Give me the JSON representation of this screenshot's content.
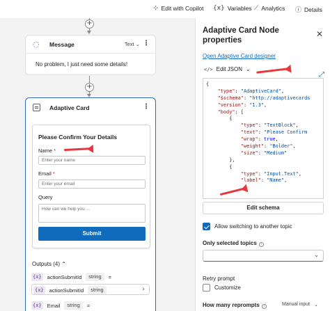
{
  "toolbar": {
    "edit_with_copilot": "Edit with Copilot",
    "variables": "Variables",
    "analytics": "Analytics",
    "details": "Details"
  },
  "message_node": {
    "title": "Message",
    "type_selector": "Text",
    "body": "No problem, I just need some details!"
  },
  "card_node": {
    "title": "Adaptive Card",
    "form": {
      "title": "Please Confirm Your Details",
      "name_label": "Name",
      "required_mark": "*",
      "name_placeholder": "Enter your name",
      "email_label": "Email",
      "email_required_mark": "*",
      "email_placeholder": "Enter your email",
      "query_label": "Query",
      "query_placeholder": "How can we help you ...",
      "submit_label": "Submit"
    },
    "outputs": {
      "header": "Outputs (4)",
      "rows": [
        {
          "name": "actionSubmitId",
          "type": "string",
          "suffix": "="
        },
        {
          "name": "actionSubmitId",
          "type": "string"
        },
        {
          "name": "Email",
          "type": "string",
          "suffix": "="
        }
      ]
    }
  },
  "panel": {
    "title": "Adaptive Card Node properties",
    "designer_link": "Open Adaptive Card designer",
    "edit_json_label": "Edit JSON",
    "json_lines": [
      [
        {
          "t": "{",
          "c": "jb"
        }
      ],
      [
        {
          "t": "    ",
          "c": "jb"
        },
        {
          "t": "\"type\"",
          "c": "jk"
        },
        {
          "t": ": ",
          "c": "jb"
        },
        {
          "t": "\"AdaptiveCard\"",
          "c": "js"
        },
        {
          "t": ",",
          "c": "jb"
        }
      ],
      [
        {
          "t": "    ",
          "c": "jb"
        },
        {
          "t": "\"$schema\"",
          "c": "jk"
        },
        {
          "t": ": ",
          "c": "jb"
        },
        {
          "t": "\"http://adaptivecards",
          "c": "js"
        }
      ],
      [
        {
          "t": "    ",
          "c": "jb"
        },
        {
          "t": "\"version\"",
          "c": "jk"
        },
        {
          "t": ": ",
          "c": "jb"
        },
        {
          "t": "\"1.3\"",
          "c": "js"
        },
        {
          "t": ",",
          "c": "jb"
        }
      ],
      [
        {
          "t": "    ",
          "c": "jb"
        },
        {
          "t": "\"body\"",
          "c": "jk"
        },
        {
          "t": ": [",
          "c": "jb"
        }
      ],
      [
        {
          "t": "        {",
          "c": "jb"
        }
      ],
      [
        {
          "t": "            ",
          "c": "jb"
        },
        {
          "t": "\"type\"",
          "c": "jk"
        },
        {
          "t": ": ",
          "c": "jb"
        },
        {
          "t": "\"TextBlock\"",
          "c": "js"
        },
        {
          "t": ",",
          "c": "jb"
        }
      ],
      [
        {
          "t": "            ",
          "c": "jb"
        },
        {
          "t": "\"text\"",
          "c": "jk"
        },
        {
          "t": ": ",
          "c": "jb"
        },
        {
          "t": "\"Please Confirm",
          "c": "js"
        }
      ],
      [
        {
          "t": "            ",
          "c": "jb"
        },
        {
          "t": "\"wrap\"",
          "c": "jk"
        },
        {
          "t": ": ",
          "c": "jb"
        },
        {
          "t": "true",
          "c": "jkw"
        },
        {
          "t": ",",
          "c": "jb"
        }
      ],
      [
        {
          "t": "            ",
          "c": "jb"
        },
        {
          "t": "\"weight\"",
          "c": "jk"
        },
        {
          "t": ": ",
          "c": "jb"
        },
        {
          "t": "\"Bolder\"",
          "c": "js"
        },
        {
          "t": ",",
          "c": "jb"
        }
      ],
      [
        {
          "t": "            ",
          "c": "jb"
        },
        {
          "t": "\"size\"",
          "c": "jk"
        },
        {
          "t": ": ",
          "c": "jb"
        },
        {
          "t": "\"Medium\"",
          "c": "js"
        }
      ],
      [
        {
          "t": "        },",
          "c": "jb"
        }
      ],
      [
        {
          "t": "        {",
          "c": "jb"
        }
      ],
      [
        {
          "t": "            ",
          "c": "jb"
        },
        {
          "t": "\"type\"",
          "c": "jk"
        },
        {
          "t": ": ",
          "c": "jb"
        },
        {
          "t": "\"Input.Text\"",
          "c": "js"
        },
        {
          "t": ",",
          "c": "jb"
        }
      ],
      [
        {
          "t": "            ",
          "c": "jb"
        },
        {
          "t": "\"label\"",
          "c": "jk"
        },
        {
          "t": ": ",
          "c": "jb"
        },
        {
          "t": "\"Name\"",
          "c": "js"
        },
        {
          "t": ",",
          "c": "jb"
        }
      ]
    ],
    "edit_schema": "Edit schema",
    "allow_switching": "Allow switching to another topic",
    "only_selected_topics": "Only selected topics",
    "retry_prompt": "Retry prompt",
    "customize": "Customize",
    "how_many_reprompts": "How many reprompts",
    "manual_input": "Manual input"
  },
  "colors": {
    "accent": "#0f6cbd",
    "annotation_red": "#e8383d",
    "selected_border": "#2a6bbf"
  }
}
